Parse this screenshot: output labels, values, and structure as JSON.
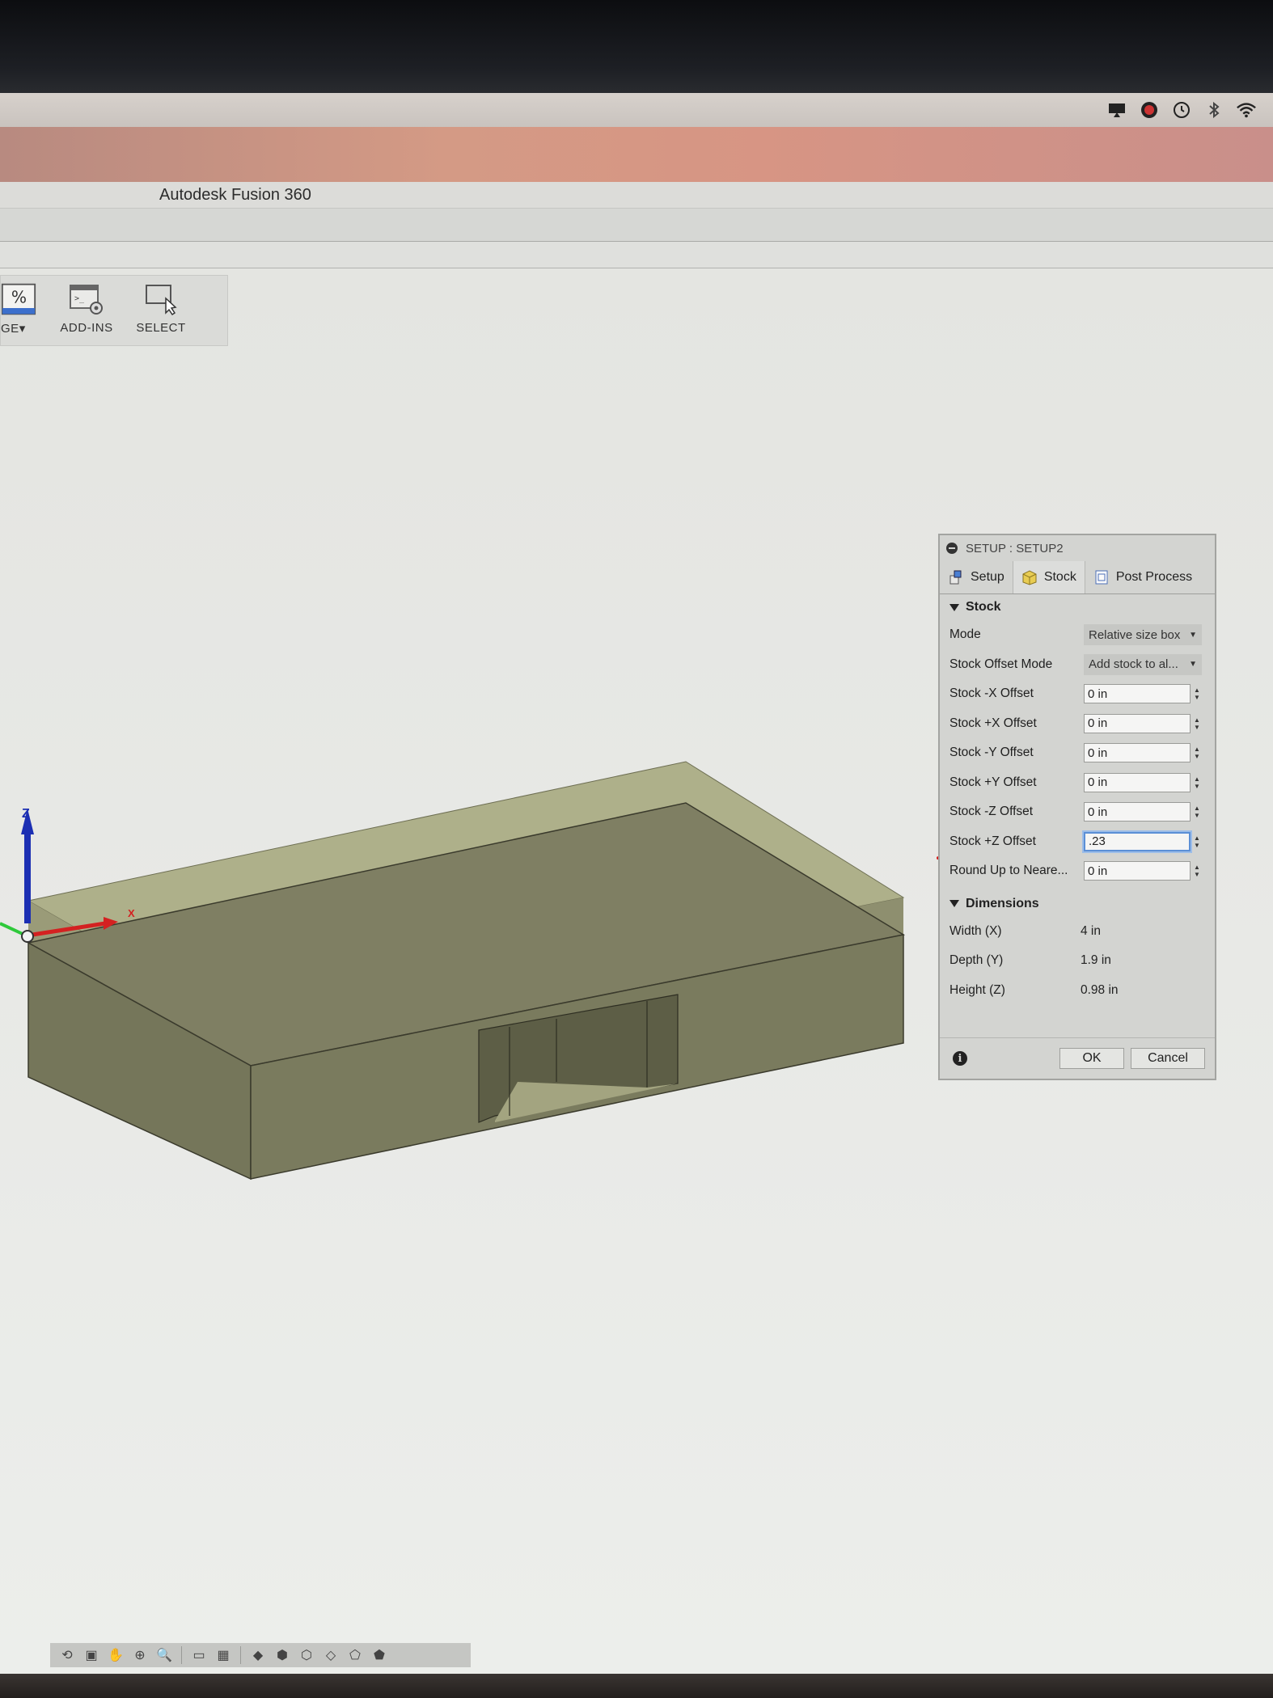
{
  "window": {
    "title": "Autodesk Fusion 360"
  },
  "toolbar": {
    "items": [
      {
        "label": "GE",
        "icon": "percent-icon"
      },
      {
        "label": "ADD-INS",
        "icon": "addins-icon"
      },
      {
        "label": "SELECT",
        "icon": "select-icon"
      }
    ]
  },
  "viewport": {
    "axis_z": "Z",
    "axis_x": "X"
  },
  "dialog": {
    "title": "SETUP : SETUP2",
    "tabs": [
      {
        "label": "Setup",
        "icon": "setup-icon"
      },
      {
        "label": "Stock",
        "icon": "stock-cube-icon"
      },
      {
        "label": "Post Process",
        "icon": "post-process-icon"
      }
    ],
    "active_tab": "Stock",
    "stock_section": "Stock",
    "mode": {
      "label": "Mode",
      "value": "Relative size box"
    },
    "offset_mode": {
      "label": "Stock Offset Mode",
      "value": "Add stock to al..."
    },
    "offsets": [
      {
        "label": "Stock -X Offset",
        "value": "0 in"
      },
      {
        "label": "Stock +X Offset",
        "value": "0 in"
      },
      {
        "label": "Stock -Y Offset",
        "value": "0 in"
      },
      {
        "label": "Stock +Y Offset",
        "value": "0 in"
      },
      {
        "label": "Stock -Z Offset",
        "value": "0 in"
      },
      {
        "label": "Stock +Z Offset",
        "value": ".23"
      },
      {
        "label": "Round Up to Neare...",
        "value": "0 in"
      }
    ],
    "dimensions_section": "Dimensions",
    "dimensions": [
      {
        "label": "Width (X)",
        "value": "4 in"
      },
      {
        "label": "Depth (Y)",
        "value": "1.9 in"
      },
      {
        "label": "Height (Z)",
        "value": "0.98 in"
      }
    ],
    "ok_label": "OK",
    "cancel_label": "Cancel",
    "info_glyph": "i"
  },
  "colors": {
    "model_face": "#8a8a6e",
    "stock_overlay": "#b8b98f",
    "axis_z": "#1c2fb3",
    "axis_x": "#d42121",
    "focus": "#5b8fd6",
    "annotation": "#d41c1c"
  }
}
